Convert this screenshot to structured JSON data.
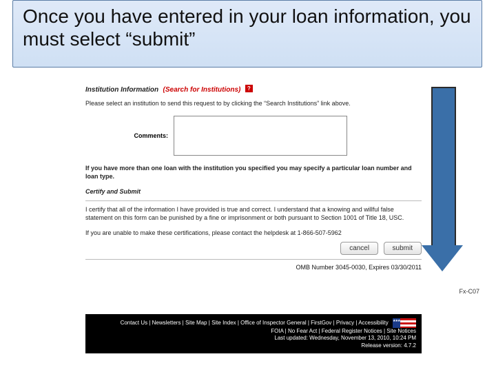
{
  "banner": {
    "text": "Once you have entered in your loan information, you must select “submit”"
  },
  "section": {
    "title": "Institution Information",
    "search_link": "(Search for Institutions)",
    "instruction": "Please select an institution to send this request to by clicking the “Search Institutions” link above.",
    "comments_label": "Comments:",
    "multi_loan_note": "If you have more than one loan with the institution you specified you may specify a particular loan number and loan type.",
    "certify_title": "Certify and Submit",
    "certify_text": "I certify that all of the information I have provided is true and correct. I understand that a knowing and willful false statement on this form can be punished by a fine or imprisonment or both pursuant to Section 1001 of Title 18, USC.",
    "helpdesk_text": "If you are unable to make these certifications, please contact the helpdesk at 1-866-507-5962"
  },
  "buttons": {
    "cancel": "cancel",
    "submit": "submit"
  },
  "omb": "OMB Number 3045-0030, Expires 03/30/2011",
  "form_code": "Fx-C07",
  "footer": {
    "links": "Contact Us | Newsletters | Site Map | Site Index | Office of Inspector General | FirstGov | Privacy | Accessibility",
    "line2": "FOIA | No Fear Act | Federal Register Notices | Site Notices",
    "updated": "Last updated: Wednesday, November 13, 2010, 10:24 PM",
    "release": "Release version: 4.7.2"
  }
}
